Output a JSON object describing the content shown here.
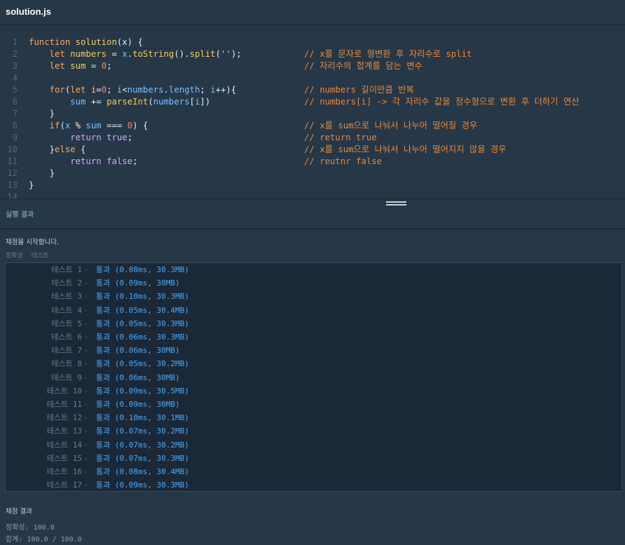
{
  "file_tab": {
    "label": "solution.js"
  },
  "editor": {
    "lines": [
      {
        "n": "1",
        "code": [
          [
            "kw",
            "function"
          ],
          [
            "pu",
            " "
          ],
          [
            "fn",
            "solution"
          ],
          [
            "pu",
            "(x) {"
          ]
        ],
        "comment": ""
      },
      {
        "n": "2",
        "code": [
          [
            "pu",
            "    "
          ],
          [
            "kw",
            "let"
          ],
          [
            "pu",
            " "
          ],
          [
            "fn",
            "numbers"
          ],
          [
            "pu",
            " = "
          ],
          [
            "var",
            "x"
          ],
          [
            "pu",
            "."
          ],
          [
            "fn",
            "toString"
          ],
          [
            "pu",
            "()."
          ],
          [
            "fn",
            "split"
          ],
          [
            "pu",
            "("
          ],
          [
            "str",
            "''"
          ],
          [
            "pu",
            ");"
          ]
        ],
        "comment": "// x를 문자로 형변환 후 자리수로 split"
      },
      {
        "n": "3",
        "code": [
          [
            "pu",
            "    "
          ],
          [
            "kw",
            "let"
          ],
          [
            "pu",
            " "
          ],
          [
            "fn",
            "sum"
          ],
          [
            "pu",
            " = "
          ],
          [
            "num",
            "0"
          ],
          [
            "pu",
            ";"
          ]
        ],
        "comment": "// 자리수의 합계를 담는 변수"
      },
      {
        "n": "4",
        "code": [],
        "comment": ""
      },
      {
        "n": "5",
        "code": [
          [
            "pu",
            "    "
          ],
          [
            "kw",
            "for"
          ],
          [
            "pu",
            "("
          ],
          [
            "kw",
            "let"
          ],
          [
            "pu",
            " "
          ],
          [
            "fn",
            "i"
          ],
          [
            "pu",
            "="
          ],
          [
            "num",
            "0"
          ],
          [
            "pu",
            "; "
          ],
          [
            "var",
            "i"
          ],
          [
            "pu",
            "<"
          ],
          [
            "var",
            "numbers"
          ],
          [
            "pu",
            "."
          ],
          [
            "var",
            "length"
          ],
          [
            "pu",
            "; "
          ],
          [
            "var",
            "i"
          ],
          [
            "pu",
            "++){"
          ]
        ],
        "comment": "// numbers 길이만큼 반복"
      },
      {
        "n": "6",
        "code": [
          [
            "pu",
            "        "
          ],
          [
            "var",
            "sum"
          ],
          [
            "pu",
            " += "
          ],
          [
            "fn",
            "parseInt"
          ],
          [
            "pu",
            "("
          ],
          [
            "var",
            "numbers"
          ],
          [
            "pu",
            "["
          ],
          [
            "var",
            "i"
          ],
          [
            "pu",
            "])"
          ]
        ],
        "comment": "// numbers[i] -> 각 자리수 값을 정수형으로 변환 후 더하기 연산"
      },
      {
        "n": "7",
        "code": [
          [
            "pu",
            "    }"
          ]
        ],
        "comment": ""
      },
      {
        "n": "8",
        "code": [
          [
            "pu",
            "    "
          ],
          [
            "kw",
            "if"
          ],
          [
            "pu",
            "("
          ],
          [
            "var",
            "x"
          ],
          [
            "pu",
            " % "
          ],
          [
            "var",
            "sum"
          ],
          [
            "pu",
            " === "
          ],
          [
            "num",
            "0"
          ],
          [
            "pu",
            ") {"
          ]
        ],
        "comment": "// x를 sum으로 나눠서 나누어 떨어질 경우"
      },
      {
        "n": "9",
        "code": [
          [
            "pu",
            "        "
          ],
          [
            "purple",
            "return"
          ],
          [
            "pu",
            " "
          ],
          [
            "purple",
            "true"
          ],
          [
            "pu",
            ";"
          ]
        ],
        "comment": "// return true"
      },
      {
        "n": "10",
        "code": [
          [
            "pu",
            "    }"
          ],
          [
            "kw",
            "else"
          ],
          [
            "pu",
            " {"
          ]
        ],
        "comment": "// x를 sum으로 나눠서 나누어 떨어지지 않을 경우"
      },
      {
        "n": "11",
        "code": [
          [
            "pu",
            "        "
          ],
          [
            "purple",
            "return"
          ],
          [
            "pu",
            " "
          ],
          [
            "purple",
            "false"
          ],
          [
            "pu",
            ";"
          ]
        ],
        "comment": "// reutnr false"
      },
      {
        "n": "12",
        "code": [
          [
            "pu",
            "    }"
          ]
        ],
        "comment": ""
      },
      {
        "n": "13",
        "code": [
          [
            "pu",
            "}"
          ]
        ],
        "comment": ""
      },
      {
        "n": "14",
        "code": [],
        "comment": ""
      }
    ]
  },
  "result": {
    "header": "실행 결과",
    "message": "채점을 시작합니다.",
    "columns": [
      "정확성",
      "테스트"
    ],
    "tests": [
      {
        "name": "테스트 1",
        "result": "통과 (0.08ms, 30.3MB)"
      },
      {
        "name": "테스트 2",
        "result": "통과 (0.09ms, 30MB)"
      },
      {
        "name": "테스트 3",
        "result": "통과 (0.10ms, 30.3MB)"
      },
      {
        "name": "테스트 4",
        "result": "통과 (0.05ms, 30.4MB)"
      },
      {
        "name": "테스트 5",
        "result": "통과 (0.05ms, 30.3MB)"
      },
      {
        "name": "테스트 6",
        "result": "통과 (0.06ms, 30.3MB)"
      },
      {
        "name": "테스트 7",
        "result": "통과 (0.06ms, 30MB)"
      },
      {
        "name": "테스트 8",
        "result": "통과 (0.05ms, 30.2MB)"
      },
      {
        "name": "테스트 9",
        "result": "통과 (0.06ms, 30MB)"
      },
      {
        "name": "테스트 10",
        "result": "통과 (0.09ms, 30.5MB)"
      },
      {
        "name": "테스트 11",
        "result": "통과 (0.09ms, 30MB)"
      },
      {
        "name": "테스트 12",
        "result": "통과 (0.10ms, 30.1MB)"
      },
      {
        "name": "테스트 13",
        "result": "통과 (0.07ms, 30.2MB)"
      },
      {
        "name": "테스트 14",
        "result": "통과 (0.07ms, 30.2MB)"
      },
      {
        "name": "테스트 15",
        "result": "통과 (0.07ms, 30.3MB)"
      },
      {
        "name": "테스트 16",
        "result": "통과 (0.08ms, 30.4MB)"
      },
      {
        "name": "테스트 17",
        "result": "통과 (0.09ms, 30.3MB)"
      }
    ],
    "summary": {
      "title": "채점 결과",
      "accuracy": "정확성: 100.0",
      "total": "합계: 100.0 / 100.0"
    }
  }
}
